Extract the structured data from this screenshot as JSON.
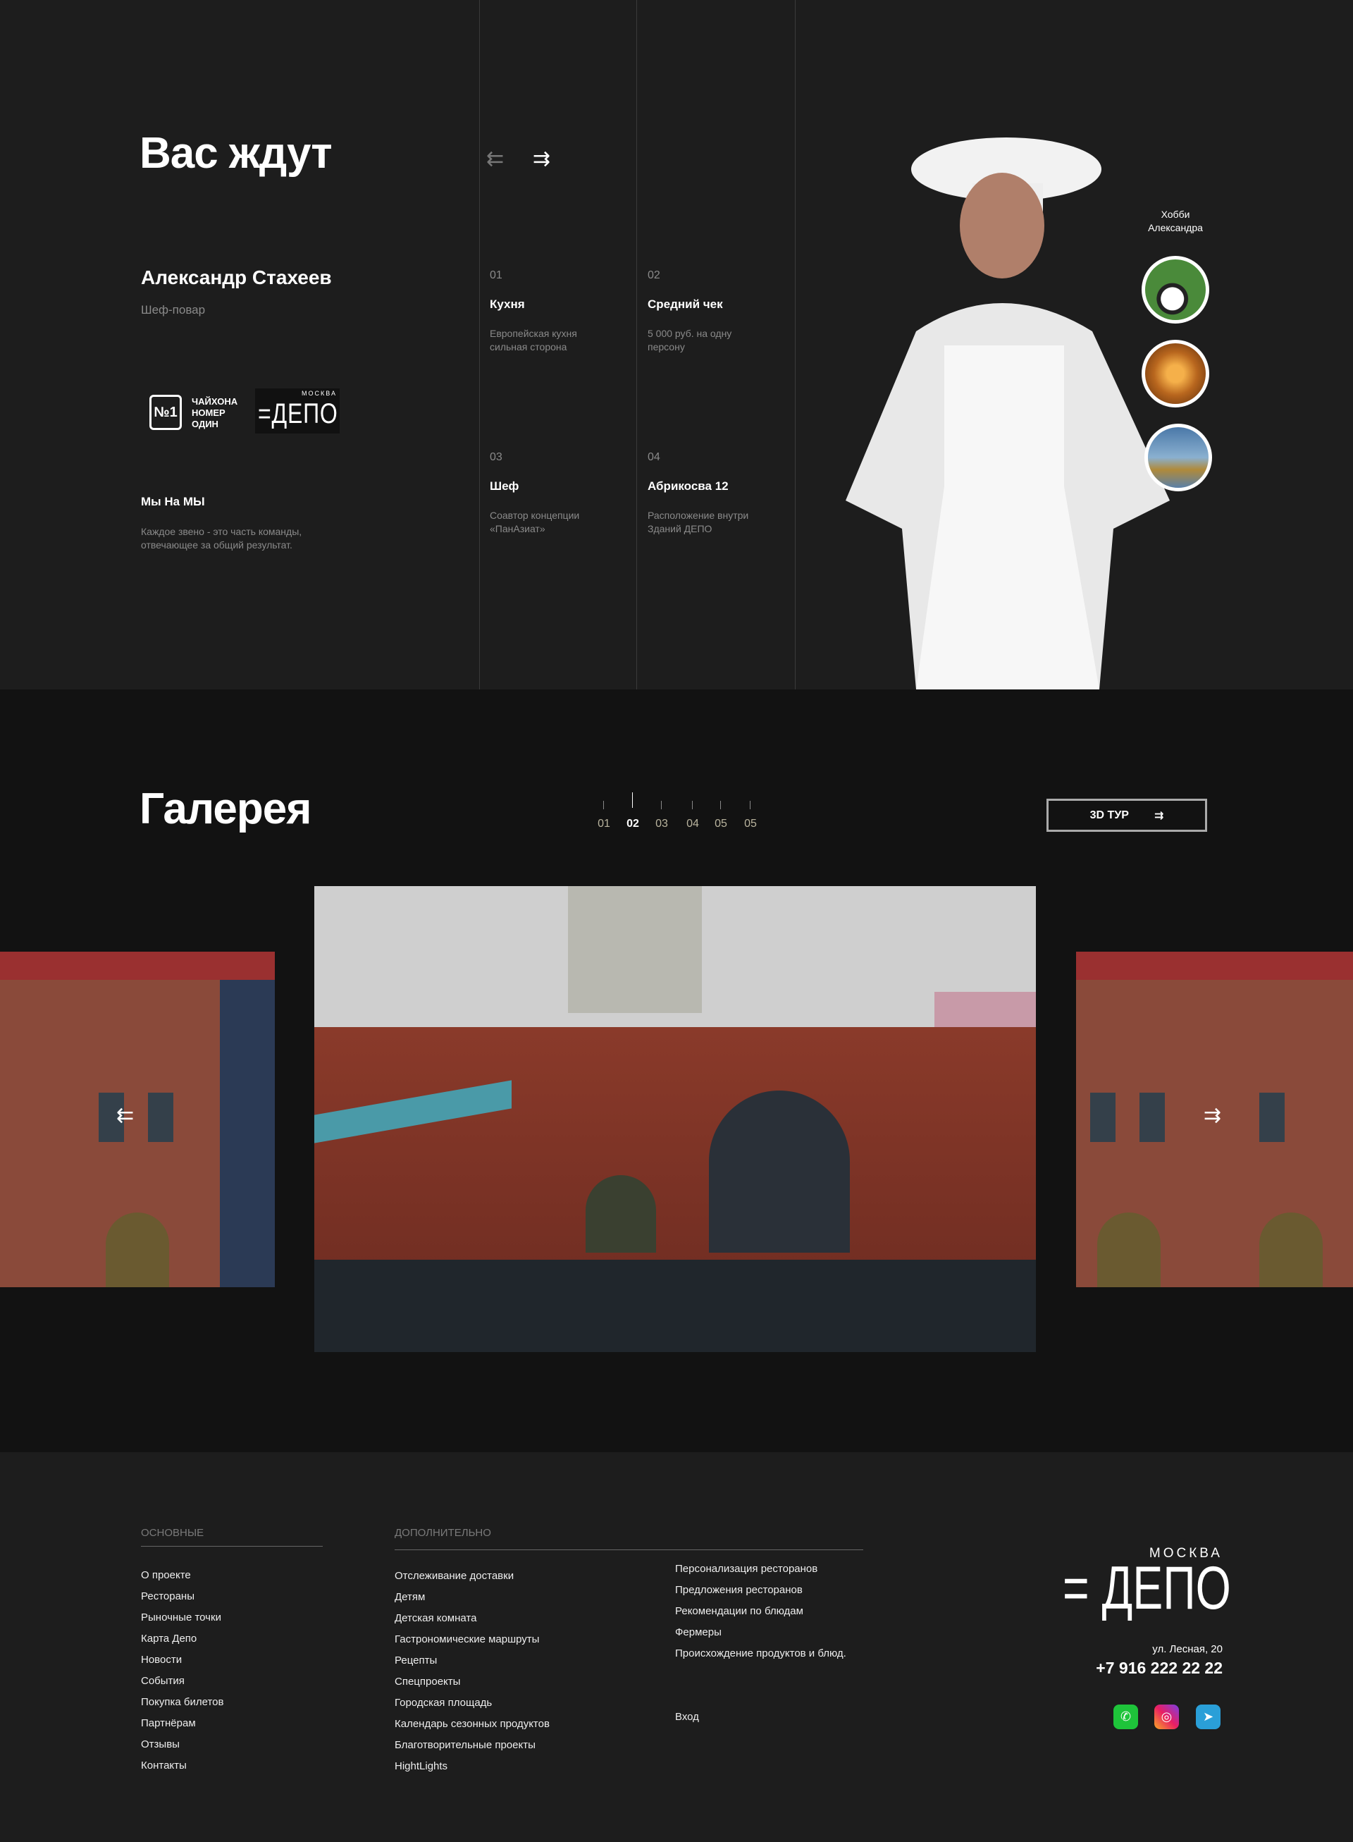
{
  "chefs": {
    "title": "Вас ждут",
    "name": "Александр Стахеев",
    "role": "Шеф-повар",
    "logos": {
      "chaihona": "ЧАЙХОНА НОМЕР ОДИН",
      "depo_city": "МОСКВА",
      "depo": "ДЕПО"
    },
    "team_title": "Мы На МЫ",
    "team_desc": "Каждое звено - это  часть команды, отвечающее за общий результат.",
    "facts": [
      {
        "num": "01",
        "title": "Кухня",
        "desc": "Европейская кухня сильная сторона"
      },
      {
        "num": "02",
        "title": "Средний чек",
        "desc": "5 000 руб. на одну персону"
      },
      {
        "num": "03",
        "title": "Шеф",
        "desc": "Соавтор концепции «ПанАзиат»"
      },
      {
        "num": "04",
        "title": "Абрикосва 12",
        "desc": "Расположение внутри Зданий ДЕПО"
      }
    ],
    "hobby_label": "Хобби Александра",
    "hobbies": [
      "football",
      "sauna",
      "fishing"
    ]
  },
  "gallery": {
    "title": "Галерея",
    "pages": [
      "01",
      "02",
      "03",
      "04",
      "05",
      "05"
    ],
    "active_page": "02",
    "tour_label": "3D ТУР"
  },
  "footer": {
    "main_heading": "ОСНОВНЫЕ",
    "main_links": [
      "О проекте",
      "Рестораны",
      "Рыночные точки",
      "Карта Депо",
      "Новости",
      "События",
      "Покупка билетов",
      "Партнёрам",
      "Отзывы",
      "Контакты"
    ],
    "extra_heading": "ДОПОЛНИТЕЛЬНО",
    "extra_links": [
      "Отслеживание доставки",
      "Детям",
      "Детская комната",
      "Гастрономические маршруты",
      "Рецепты",
      "Спецпроекты",
      "Городская площадь",
      "Календарь сезонных продуктов",
      "Благотворительные проекты",
      "HightLights"
    ],
    "extra_links2": [
      "Персонализация ресторанов",
      "Предложения ресторанов",
      "Рекомендации по блюдам",
      "Фермеры",
      "Происхождение продуктов и блюд."
    ],
    "login": "Вход",
    "logo_city": "МОСКВА",
    "logo": "ДЕПО",
    "address": "ул. Лесная, 20",
    "phone": "+7 916 222 22 22",
    "social": [
      "whatsapp",
      "instagram",
      "telegram"
    ]
  }
}
